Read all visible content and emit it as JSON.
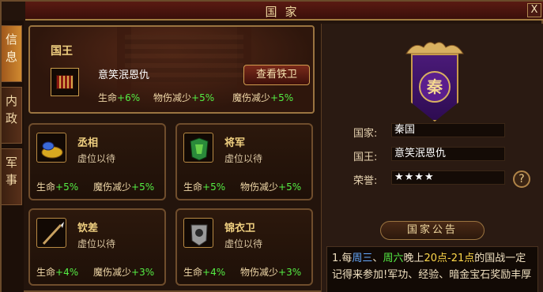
{
  "window": {
    "title": "国家",
    "close_label": "X"
  },
  "side_tabs": [
    {
      "chars": [
        "信",
        "息"
      ]
    },
    {
      "chars": [
        "内",
        "政"
      ]
    },
    {
      "chars": [
        "军",
        "事"
      ]
    }
  ],
  "king": {
    "rank": "国王",
    "holder": "意笑泯恩仇",
    "view_button": "查看铁卫",
    "stats": [
      {
        "label": "生命",
        "value": "+6%"
      },
      {
        "label": "物伤减少",
        "value": "+5%"
      },
      {
        "label": "魔伤减少",
        "value": "+5%"
      }
    ]
  },
  "offices": [
    {
      "rank": "丞相",
      "holder": "虚位以待",
      "stats": [
        {
          "label": "生命",
          "value": "+5%"
        },
        {
          "label": "魔伤减少",
          "value": "+5%"
        }
      ]
    },
    {
      "rank": "将军",
      "holder": "虚位以待",
      "stats": [
        {
          "label": "生命",
          "value": "+5%"
        },
        {
          "label": "物伤减少",
          "value": "+5%"
        }
      ]
    },
    {
      "rank": "钦差",
      "holder": "虚位以待",
      "stats": [
        {
          "label": "生命",
          "value": "+4%"
        },
        {
          "label": "魔伤减少",
          "value": "+3%"
        }
      ]
    },
    {
      "rank": "锦衣卫",
      "holder": "虚位以待",
      "stats": [
        {
          "label": "生命",
          "value": "+4%"
        },
        {
          "label": "物伤减少",
          "value": "+3%"
        }
      ]
    }
  ],
  "nation": {
    "emblem_char": "秦",
    "rows": [
      {
        "label": "国家:",
        "value": "秦国"
      },
      {
        "label": "国王:",
        "value": "意笑泯恩仇"
      },
      {
        "label": "荣誉:",
        "value": "★★★★"
      }
    ],
    "help_label": "?"
  },
  "notice": {
    "title": "国家公告",
    "parts": [
      {
        "text": "1.每",
        "color": "#f0e0c0"
      },
      {
        "text": "周三",
        "color": "#66aaff"
      },
      {
        "text": "、",
        "color": "#f0e0c0"
      },
      {
        "text": "周六",
        "color": "#55ee44"
      },
      {
        "text": "晚上",
        "color": "#f0e0c0"
      },
      {
        "text": "20点-21点",
        "color": "#ffd84a"
      },
      {
        "text": "的国战一定记得来参加!军功、经验、暗金宝石奖励丰厚",
        "color": "#f0e0c0"
      }
    ]
  }
}
